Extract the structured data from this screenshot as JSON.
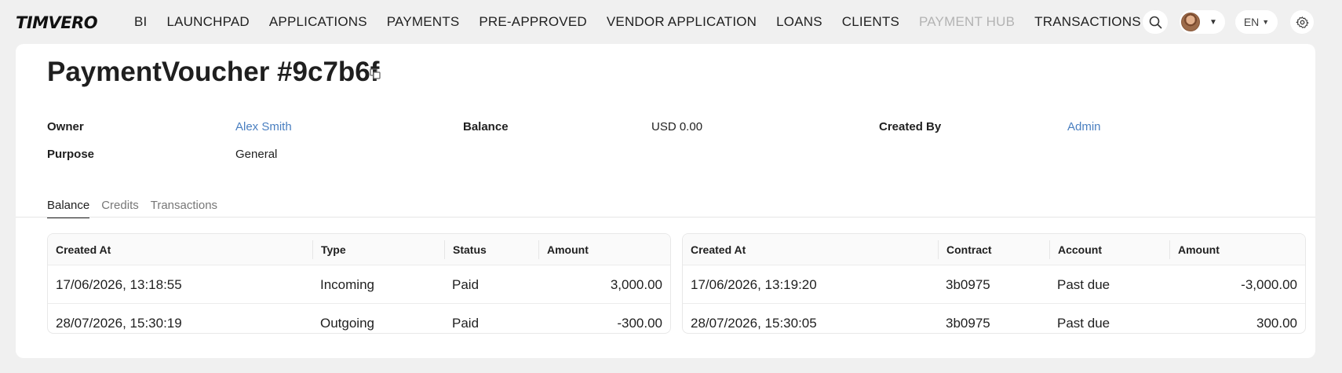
{
  "app": {
    "logo": "TIMVERO"
  },
  "nav": [
    {
      "label": "BI",
      "muted": false
    },
    {
      "label": "LAUNCHPAD",
      "muted": false
    },
    {
      "label": "APPLICATIONS",
      "muted": false
    },
    {
      "label": "PAYMENTS",
      "muted": false
    },
    {
      "label": "PRE-APPROVED",
      "muted": false
    },
    {
      "label": "VENDOR APPLICATION",
      "muted": false
    },
    {
      "label": "LOANS",
      "muted": false
    },
    {
      "label": "CLIENTS",
      "muted": false
    },
    {
      "label": "PAYMENT HUB",
      "muted": true
    },
    {
      "label": "TRANSACTIONS",
      "muted": false
    }
  ],
  "topActions": {
    "language": "EN",
    "icons": [
      "search-icon",
      "avatar",
      "chevron-down-icon",
      "gear-icon"
    ]
  },
  "page": {
    "title": "PaymentVoucher #9c7b6f"
  },
  "info": {
    "owner_label": "Owner",
    "owner_value": "Alex Smith",
    "purpose_label": "Purpose",
    "purpose_value": "General",
    "balance_label": "Balance",
    "balance_value": "USD 0.00",
    "created_by_label": "Created By",
    "created_by_value": "Admin"
  },
  "tabs": [
    {
      "label": "Balance",
      "active": true
    },
    {
      "label": "Credits",
      "active": false
    },
    {
      "label": "Transactions",
      "active": false
    }
  ],
  "leftTable": {
    "headers": [
      "Created At",
      "Type",
      "Status",
      "Amount"
    ],
    "rows": [
      [
        "17/06/2026, 13:18:55",
        "Incoming",
        "Paid",
        "3,000.00"
      ],
      [
        "28/07/2026, 15:30:19",
        "Outgoing",
        "Paid",
        "-300.00"
      ]
    ]
  },
  "rightTable": {
    "headers": [
      "Created At",
      "Contract",
      "Account",
      "Amount"
    ],
    "rows": [
      [
        "17/06/2026, 13:19:20",
        "3b0975",
        "Past due",
        "-3,000.00"
      ],
      [
        "28/07/2026, 15:30:05",
        "3b0975",
        "Past due",
        "300.00"
      ]
    ]
  },
  "colors": {
    "link": "#4a7fc0",
    "muted_nav": "#b3b3b3",
    "background": "#f0f0f0"
  }
}
